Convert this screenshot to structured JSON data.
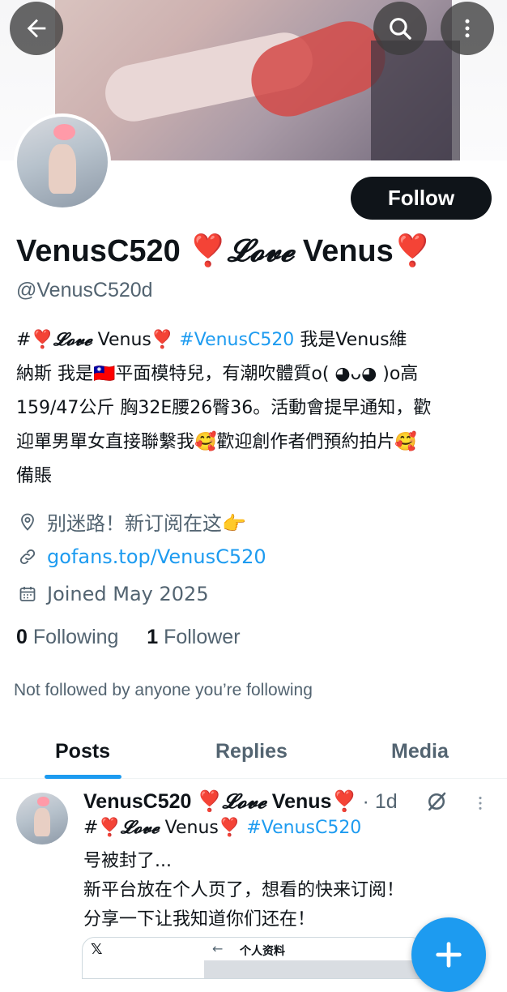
{
  "header": {
    "back_icon": "arrow-left-icon",
    "search_icon": "search-icon",
    "more_icon": "more-vertical-icon"
  },
  "profile": {
    "follow_label": "Follow",
    "name_main": "VenusC520",
    "name_emoji": "❣️",
    "name_script": "𝓛𝓸𝓿𝓮",
    "name_end": "Venus",
    "handle": "@VenusC520d",
    "bio": {
      "hash": "#",
      "emoji": "❣️",
      "script": "𝓛𝓸𝓿𝓮",
      "venus": "Venus",
      "hashtag": "#VenusC520",
      "line1_rest": "我是Venus維",
      "line2": "納斯  我是🇹🇼平面模特兒，有潮吹體質o( ◕ᴗ◕ )o高",
      "line3": "159/47公斤 胸32E腰26臀36。活動會提早通知，歡",
      "line4": "迎單男單女直接聯繫我🥰歡迎創作者們預約拍片🥰",
      "line5": "備賬"
    },
    "location": "别迷路！新订阅在这👉",
    "website": "gofans.top/VenusC520",
    "joined": "Joined May 2025",
    "following_count": "0",
    "following_label": "Following",
    "followers_count": "1",
    "followers_label": "Follower",
    "not_followed_text": "Not followed by anyone you’re following"
  },
  "tabs": [
    {
      "label": "Posts",
      "active": true
    },
    {
      "label": "Replies",
      "active": false
    },
    {
      "label": "Media",
      "active": false
    }
  ],
  "post": {
    "name_main": "VenusC520",
    "name_emoji": "❣️",
    "name_script": "𝓛𝓸𝓿𝓮",
    "name_end": "Venus",
    "time": "· 1d",
    "line1_hash": "#",
    "line1_emoji": "❣️",
    "line1_script": "𝓛𝓸𝓿𝓮",
    "line1_venus": "Venus",
    "line1_hashtag": "#VenusC520",
    "line2": "号被封了...",
    "line3": "新平台放在个人页了，想看的快来订阅！",
    "line4": "分享一下让我知道你们还在！",
    "card_left": "𝕏",
    "card_back": "←",
    "card_title": "个人资料"
  },
  "colors": {
    "accent": "#1d9bf0",
    "text": "#0f1419",
    "muted": "#536471",
    "follow_bg": "#0f1419",
    "heart": "#ff2d6a"
  }
}
